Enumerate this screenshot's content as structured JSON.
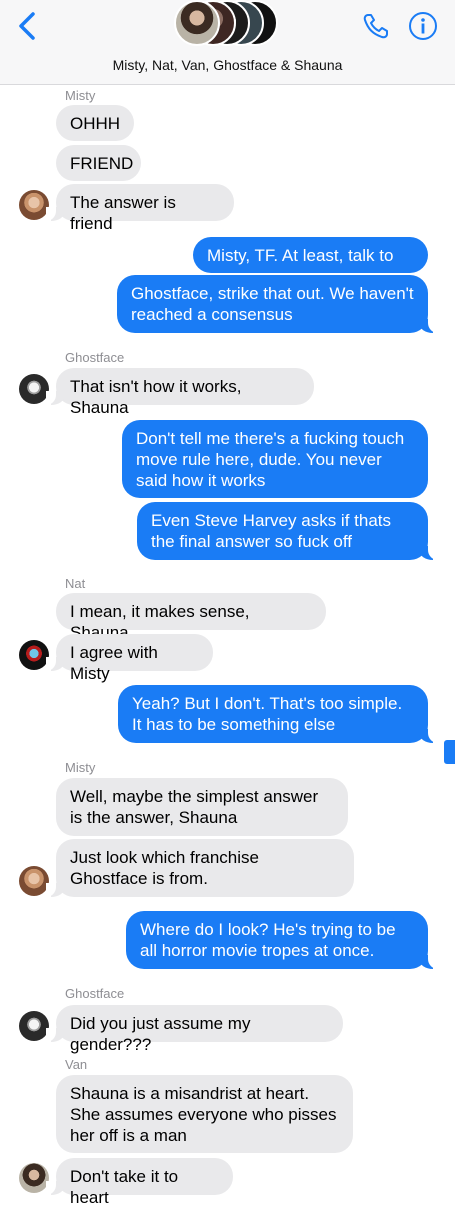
{
  "header": {
    "title": "Misty, Nat, Van, Ghostface & Shauna",
    "colors": {
      "accent": "#1a7cf5",
      "bar": "#f7f7f8"
    },
    "icons": [
      "chevron-left-icon",
      "phone-icon",
      "info-icon"
    ]
  },
  "senders": {
    "misty1": "Misty",
    "ghost1": "Ghostface",
    "nat": "Nat",
    "misty2": "Misty",
    "ghost2": "Ghostface",
    "van": "Van"
  },
  "messages": [
    {
      "from": "Misty",
      "text": "OHHH"
    },
    {
      "from": "Misty",
      "text": "FRIEND"
    },
    {
      "from": "Misty",
      "text": "The answer is friend"
    },
    {
      "from": "me",
      "text": "Misty, TF. At least, talk to us"
    },
    {
      "from": "me",
      "text": "Ghostface, strike that out. We haven't reached a consensus"
    },
    {
      "from": "Ghostface",
      "text": "That isn't how it works, Shauna"
    },
    {
      "from": "me",
      "text": "Don't tell me there's a fucking touch move rule here, dude. You never said how it works"
    },
    {
      "from": "me",
      "text": "Even Steve Harvey asks if thats the final answer so fuck off"
    },
    {
      "from": "Nat",
      "text": "I mean, it makes sense, Shauna."
    },
    {
      "from": "Nat",
      "text": "I agree with Misty"
    },
    {
      "from": "me",
      "text": "Yeah? But I don't. That's too simple. It has to be something else"
    },
    {
      "from": "Misty",
      "text": "Well, maybe the simplest answer is the answer, Shauna"
    },
    {
      "from": "Misty",
      "text": "Just look which franchise Ghostface is from."
    },
    {
      "from": "me",
      "text": "Where do I look? He's trying to be all horror movie tropes at once."
    },
    {
      "from": "Ghostface",
      "text": "Did you just assume my gender???"
    },
    {
      "from": "Van",
      "text": "Shauna is a misandrist at heart. She assumes everyone who pisses her off is a man"
    },
    {
      "from": "Van",
      "text": "Don't take it to heart"
    }
  ]
}
